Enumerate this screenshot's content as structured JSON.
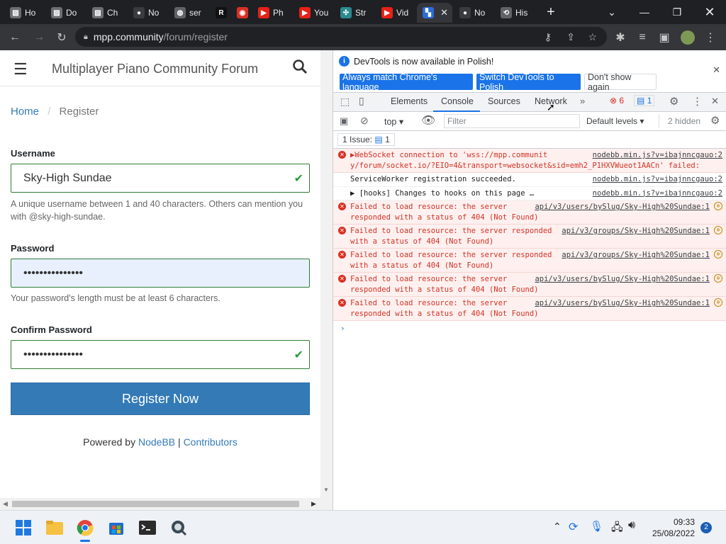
{
  "browser": {
    "tabs": [
      {
        "label": "Ho",
        "icon": "page-icon"
      },
      {
        "label": "Do",
        "icon": "page-icon"
      },
      {
        "label": "Ch",
        "icon": "page-icon"
      },
      {
        "label": "No",
        "icon": "github-icon"
      },
      {
        "label": "ser",
        "icon": "globe-icon"
      },
      {
        "label": "",
        "icon": "r-icon"
      },
      {
        "label": "",
        "icon": "record-icon"
      },
      {
        "label": "Ph",
        "icon": "youtube-icon"
      },
      {
        "label": "You",
        "icon": "youtube-icon"
      },
      {
        "label": "Str",
        "icon": "app-icon"
      },
      {
        "label": "Vid",
        "icon": "youtube-icon"
      },
      {
        "label": "",
        "icon": "nodebb-icon"
      },
      {
        "label": "No",
        "icon": "github-icon"
      },
      {
        "label": "His",
        "icon": "history-icon"
      }
    ],
    "url_host": "mpp.community",
    "url_path": "/forum/register"
  },
  "site": {
    "title": "Multiplayer Piano Community Forum",
    "breadcrumb_home": "Home",
    "breadcrumb_sep": "/",
    "breadcrumb_current": "Register",
    "username_label": "Username",
    "username_value": "Sky-High Sundae",
    "username_help": "A unique username between 1 and 40 characters. Others can mention you with @sky-high-sundae.",
    "password_label": "Password",
    "password_value": "•••••••••••••••",
    "password_help": "Your password's length must be at least 6 characters.",
    "confirm_label": "Confirm Password",
    "confirm_value": "•••••••••••••••",
    "register_button": "Register Now",
    "footer_prefix": "Powered by",
    "footer_link1": "NodeBB",
    "footer_sep": "|",
    "footer_link2": "Contributors"
  },
  "devtools": {
    "info_text": "DevTools is now available in Polish!",
    "btn_match": "Always match Chrome's language",
    "btn_switch": "Switch DevTools to Polish",
    "btn_dont": "Don't show again",
    "tabs": [
      "Elements",
      "Console",
      "Sources",
      "Network"
    ],
    "error_count": "6",
    "message_count": "1",
    "context": "top",
    "filter_placeholder": "Filter",
    "levels": "Default levels",
    "hidden": "2 hidden",
    "issues_label": "1 Issue:",
    "issues_count": "1",
    "messages": [
      {
        "type": "error",
        "text": "▶WebSocket connection to 'wss://mpp.communit y/forum/socket.io/?EIO=4&transport=websocket&sid=emh2_P1HXVWueot1AACn' failed:",
        "source": "nodebb.min.js?v=ibajnncgauo:2",
        "globe": false
      },
      {
        "type": "info",
        "text": "ServiceWorker registration succeeded.",
        "source": "nodebb.min.js?v=ibajnncgauo:2",
        "globe": false
      },
      {
        "type": "info",
        "text": "▶ [hooks] Changes to hooks on this page …",
        "source": "nodebb.min.js?v=ibajnncgauo:2",
        "globe": false
      },
      {
        "type": "error",
        "text": "Failed to load resource: the server responded with a status of 404 (Not Found)",
        "source": "api/v3/users/bySlug/Sky-High%20Sundae:1",
        "globe": true
      },
      {
        "type": "error",
        "text": "Failed to load resource: the server responded with a status of 404 (Not Found)",
        "source": "api/v3/groups/Sky-High%20Sundae:1",
        "globe": true
      },
      {
        "type": "error",
        "text": "Failed to load resource: the server responded with a status of 404 (Not Found)",
        "source": "api/v3/groups/Sky-High%20Sundae:1",
        "globe": true
      },
      {
        "type": "error",
        "text": "Failed to load resource: the server responded with a status of 404 (Not Found)",
        "source": "api/v3/users/bySlug/Sky-High%20Sundae:1",
        "globe": true
      },
      {
        "type": "error",
        "text": "Failed to load resource: the server responded with a status of 404 (Not Found)",
        "source": "api/v3/users/bySlug/Sky-High%20Sundae:1",
        "globe": true
      }
    ]
  },
  "taskbar": {
    "time": "09:33",
    "date": "25/08/2022",
    "notifications": "2"
  },
  "colors": {
    "accent": "#337ab7",
    "valid": "#2e7d32",
    "error_bg": "#fdf0ef",
    "error_text": "#d33426"
  }
}
